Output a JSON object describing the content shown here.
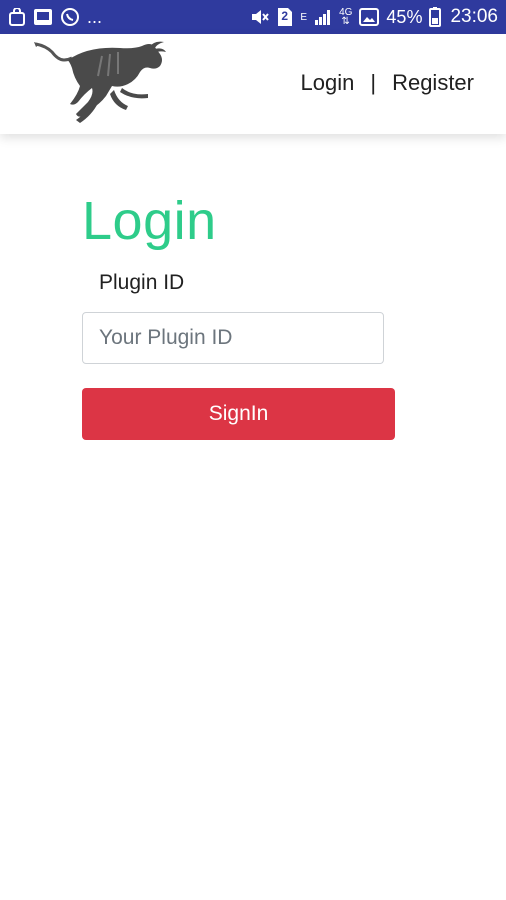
{
  "status_bar": {
    "more_indicator": "...",
    "sim_badge": "2",
    "network_type": "E",
    "data_label": "4G",
    "battery_percent": "45%",
    "time": "23:06",
    "icons": [
      "bag-icon",
      "image-icon",
      "whatsapp-icon",
      "mute-icon",
      "sim-icon",
      "signal-icon",
      "data-arrows-icon",
      "image-icon",
      "battery-icon"
    ]
  },
  "header": {
    "logo_icon": "wildebeest-logo-icon",
    "nav": {
      "login_label": "Login",
      "separator": "|",
      "register_label": "Register"
    }
  },
  "login": {
    "title": "Login",
    "field_label": "Plugin ID",
    "input_placeholder": "Your Plugin ID",
    "input_value": "",
    "submit_label": "SignIn"
  },
  "colors": {
    "status_bar": "#2f3a9e",
    "title_green": "#2ecc8a",
    "button_red": "#dc3545"
  }
}
